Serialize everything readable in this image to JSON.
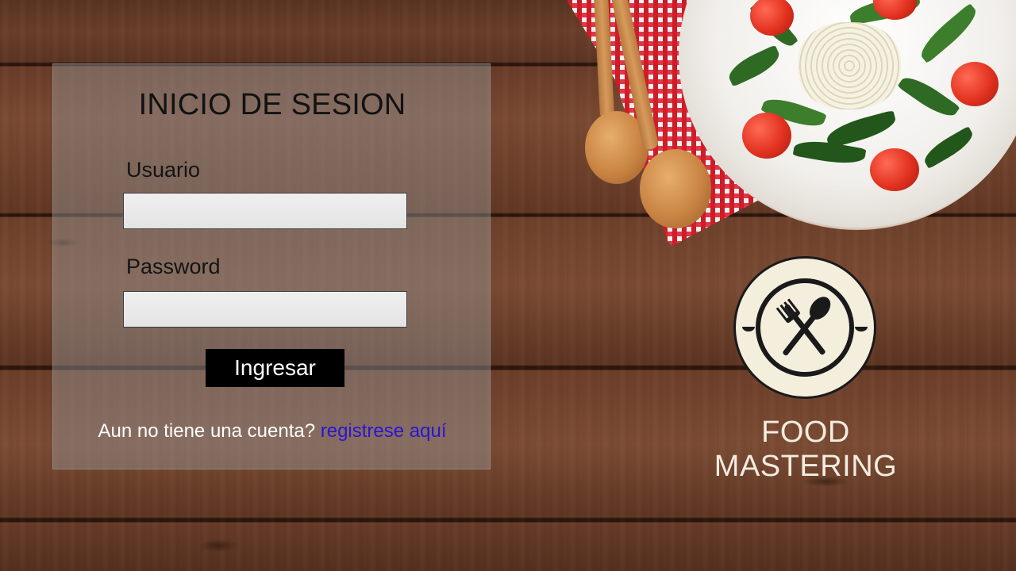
{
  "login": {
    "title": "INICIO DE SESION",
    "username_label": "Usuario",
    "username_value": "",
    "password_label": "Password",
    "password_value": "",
    "submit_label": "Ingresar",
    "signup_prompt": "Aun no tiene una cuenta?",
    "signup_link": "registrese aquí"
  },
  "brand": {
    "name": "FOOD MASTERING",
    "logo_icon": "fork-spoon-crossed-icon"
  },
  "colors": {
    "link": "#2a14d6",
    "button": "#000000",
    "brand_text": "#f2ece0"
  }
}
